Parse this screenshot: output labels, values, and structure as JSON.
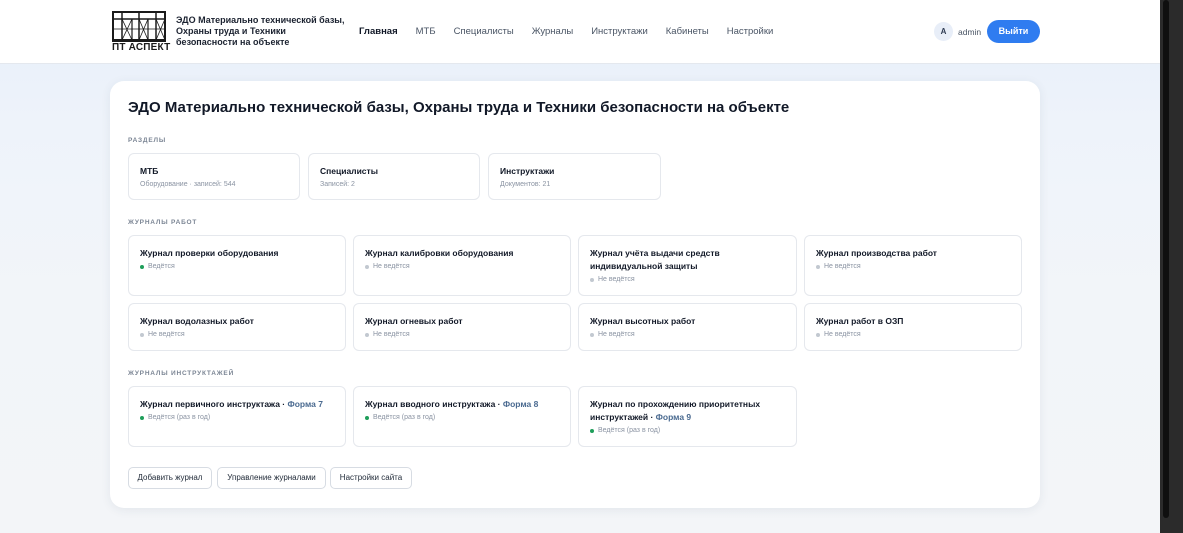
{
  "header": {
    "logo_text": "ПТ АСПЕКТ",
    "site_title": "ЭДО Материально технической базы, Охраны труда и Техники безопасности на объекте",
    "nav": [
      "Главная",
      "МТБ",
      "Специалисты",
      "Журналы",
      "Инструктажи",
      "Кабинеты",
      "Настройки"
    ],
    "avatar_letter": "A",
    "username": "admin",
    "logout_label": "Выйти"
  },
  "main": {
    "title": "ЭДО Материально технической базы, Охраны труда и Техники безопасности на объекте",
    "sections_label": "РАЗДЕЛЫ",
    "sections": [
      {
        "title": "МТБ",
        "sub": "Оборудование · записей: 544"
      },
      {
        "title": "Специалисты",
        "sub": "Записей: 2"
      },
      {
        "title": "Инструктажи",
        "sub": "Документов: 21"
      }
    ],
    "work_journals_label": "ЖУРНАЛЫ РАБОТ",
    "work_journals": [
      {
        "title": "Журнал проверки оборудования",
        "status": "Ведётся"
      },
      {
        "title": "Журнал калибровки оборудования",
        "status": "Не ведётся"
      },
      {
        "title": "Журнал учёта выдачи средств индивидуальной защиты",
        "status": "Не ведётся"
      },
      {
        "title": "Журнал производства работ",
        "status": "Не ведётся"
      },
      {
        "title": "Журнал водолазных работ",
        "status": "Не ведётся"
      },
      {
        "title": "Журнал огневых работ",
        "status": "Не ведётся"
      },
      {
        "title": "Журнал высотных работ",
        "status": "Не ведётся"
      },
      {
        "title": "Журнал работ в ОЗП",
        "status": "Не ведётся"
      }
    ],
    "instr_journals_label": "ЖУРНАЛЫ ИНСТРУКТАЖЕЙ",
    "instr_journals": [
      {
        "title": "Журнал первичного инструктажа",
        "forma": "Форма 7",
        "status": "Ведётся (раз в год)"
      },
      {
        "title": "Журнал вводного инструктажа",
        "forma": "Форма 8",
        "status": "Ведётся (раз в год)"
      },
      {
        "title": "Журнал по прохождению приоритетных инструктажей",
        "forma": "Форма 9",
        "status": "Ведётся (раз в год)"
      }
    ],
    "separator": " · ",
    "buttons": [
      "Добавить журнал",
      "Управление журналами",
      "Настройки сайта"
    ]
  },
  "colors": {
    "accent": "#2f7cf0",
    "status_on": "#1e9e5a",
    "status_off": "#c2c8d0"
  }
}
